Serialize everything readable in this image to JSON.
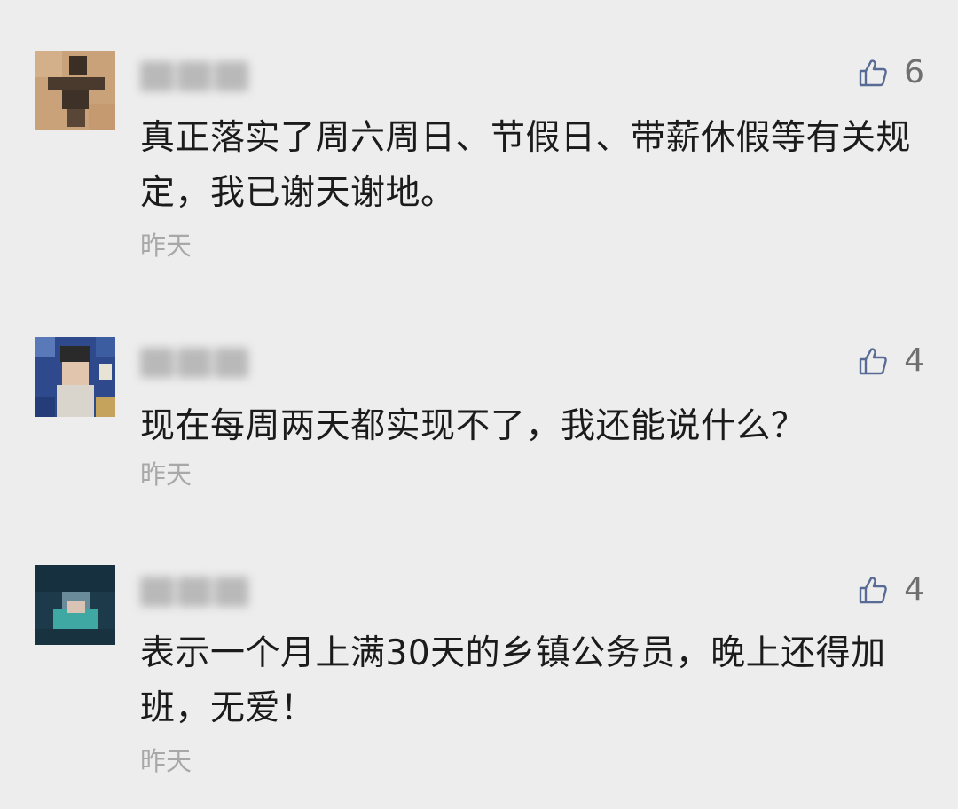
{
  "comments": [
    {
      "avatar": "blurred-avatar-1",
      "likes": "6",
      "text": "真正落实了周六周日、节假日、带薪休假等有关规定，我已谢天谢地。",
      "time": "昨天"
    },
    {
      "avatar": "blurred-avatar-2",
      "likes": "4",
      "text": "现在每周两天都实现不了，我还能说什么？",
      "time": "昨天"
    },
    {
      "avatar": "blurred-avatar-3",
      "likes": "4",
      "text": "表示一个月上满30天的乡镇公务员，晚上还得加班，无爱！",
      "time": "昨天"
    }
  ],
  "colors": {
    "background": "#ededed",
    "text": "#1b1b1b",
    "muted": "#a8a8a8",
    "like_icon": "#576b95"
  }
}
